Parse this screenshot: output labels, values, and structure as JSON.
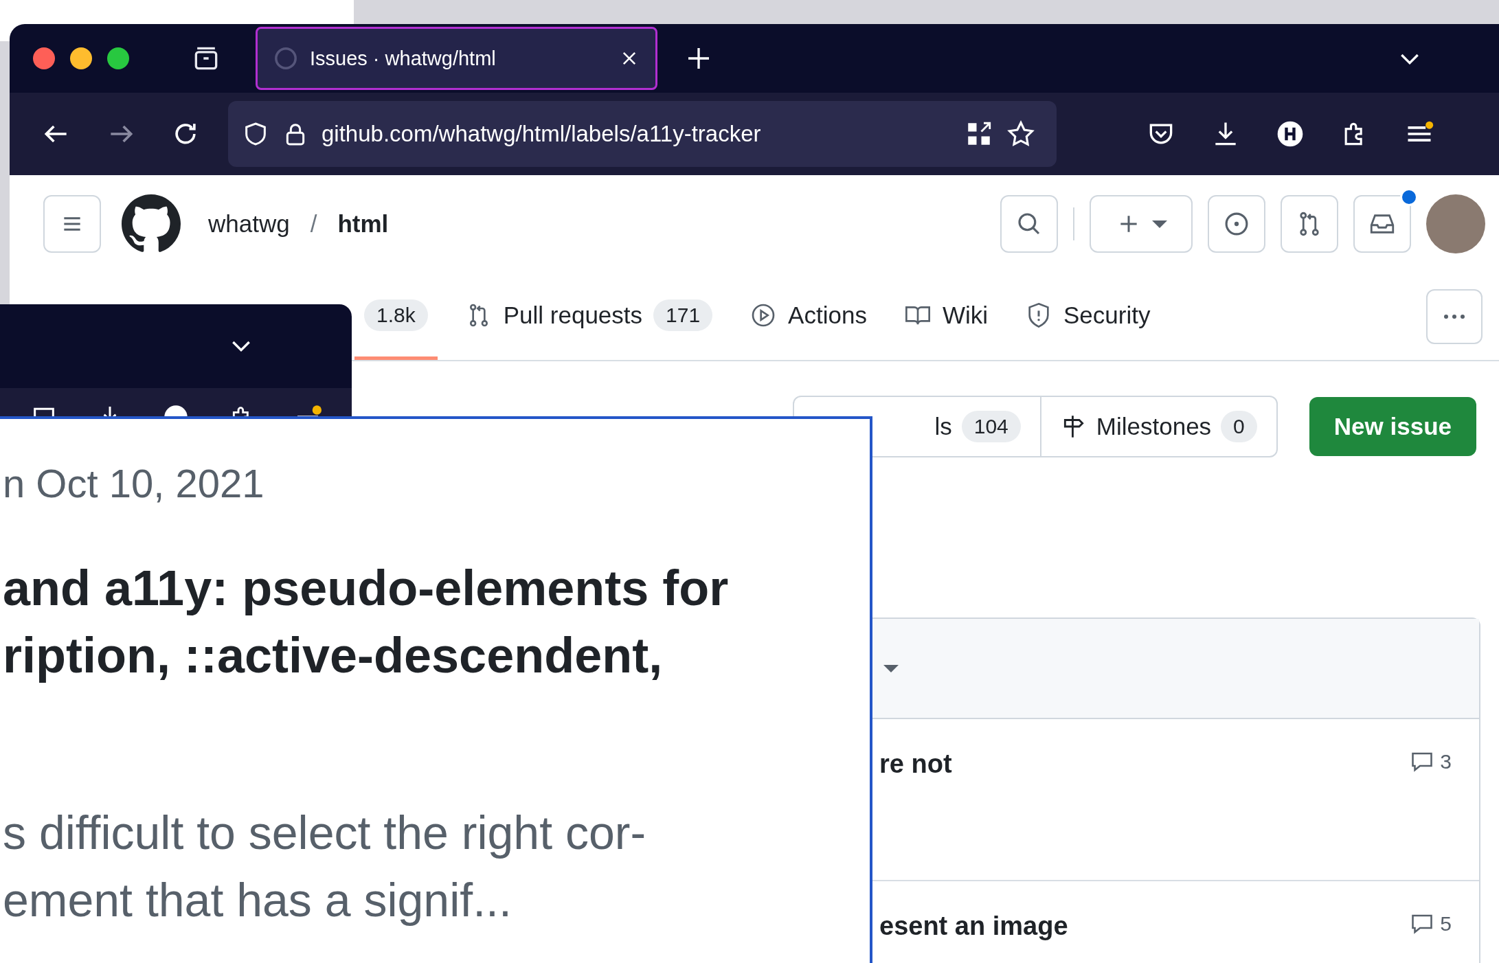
{
  "browser": {
    "tab": {
      "title": "Issues · whatwg/html",
      "selected": true
    },
    "url": "github.com/whatwg/html/labels/a11y-tracker"
  },
  "header": {
    "owner": "whatwg",
    "separator": "/",
    "repo": "html",
    "inbox_unread": true
  },
  "repo_nav": [
    {
      "kind": "issues",
      "count": "1.8k",
      "selected": true
    },
    {
      "kind": "pulls",
      "label": "Pull requests",
      "count": "171",
      "selected": false
    },
    {
      "kind": "actions",
      "label": "Actions",
      "selected": false
    },
    {
      "kind": "wiki",
      "label": "Wiki",
      "selected": false
    },
    {
      "kind": "security",
      "label": "Security",
      "selected": false
    }
  ],
  "filters": {
    "labels_label": "ls",
    "labels_count": "104",
    "milestones_label": "Milestones",
    "milestones_count": "0",
    "new_issue": "New issue"
  },
  "issues": [
    {
      "title": "re not",
      "comments": "3"
    },
    {
      "title": "esent an image",
      "comments": "5"
    }
  ],
  "popup": {
    "date": "n Oct 10, 2021",
    "title_lines": [
      "and a11y: pseudo-elements for",
      "ription, ::active-descendent,"
    ],
    "body_lines": [
      "s difficult to select the right cor-",
      "ement that has a signif..."
    ]
  }
}
